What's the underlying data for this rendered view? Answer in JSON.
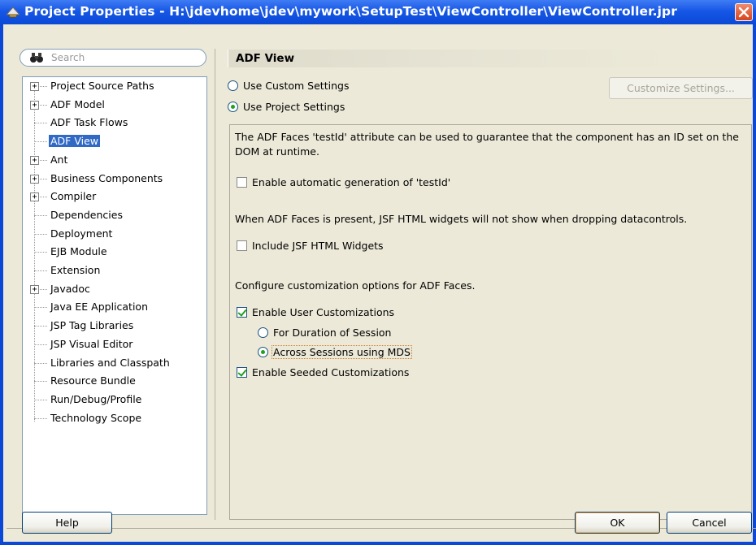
{
  "window": {
    "title": "Project Properties - H:\\jdevhome\\jdev\\mywork\\SetupTest\\ViewController\\ViewController.jpr"
  },
  "search": {
    "placeholder": "Search"
  },
  "tree": {
    "items": [
      {
        "label": "Project Source Paths",
        "expandable": true
      },
      {
        "label": "ADF Model",
        "expandable": true
      },
      {
        "label": "ADF Task Flows",
        "expandable": false
      },
      {
        "label": "ADF View",
        "expandable": false,
        "selected": true
      },
      {
        "label": "Ant",
        "expandable": true
      },
      {
        "label": "Business Components",
        "expandable": true
      },
      {
        "label": "Compiler",
        "expandable": true
      },
      {
        "label": "Dependencies",
        "expandable": false
      },
      {
        "label": "Deployment",
        "expandable": false
      },
      {
        "label": "EJB Module",
        "expandable": false
      },
      {
        "label": "Extension",
        "expandable": false
      },
      {
        "label": "Javadoc",
        "expandable": true
      },
      {
        "label": "Java EE Application",
        "expandable": false
      },
      {
        "label": "JSP Tag Libraries",
        "expandable": false
      },
      {
        "label": "JSP Visual Editor",
        "expandable": false
      },
      {
        "label": "Libraries and Classpath",
        "expandable": false
      },
      {
        "label": "Resource Bundle",
        "expandable": false
      },
      {
        "label": "Run/Debug/Profile",
        "expandable": false
      },
      {
        "label": "Technology Scope",
        "expandable": false
      }
    ]
  },
  "main": {
    "title": "ADF View",
    "use_custom_label": "Use Custom Settings",
    "use_project_label": "Use Project Settings",
    "customize_label": "Customize Settings...",
    "testid_desc": "The ADF Faces 'testId' attribute can be used to guarantee that the component has an ID set on the DOM at runtime.",
    "enable_testid_label": "Enable automatic generation of 'testId'",
    "jsf_desc": "When ADF Faces is present, JSF HTML widgets will not show when dropping datacontrols.",
    "include_jsf_label": "Include JSF HTML Widgets",
    "custom_desc": "Configure customization options for ADF Faces.",
    "enable_user_custom_label": "Enable User Customizations",
    "duration_session_label": "For Duration of Session",
    "across_sessions_label": "Across Sessions using MDS",
    "enable_seeded_label": "Enable Seeded Customizations"
  },
  "buttons": {
    "help": "Help",
    "ok": "OK",
    "cancel": "Cancel"
  },
  "state": {
    "use_project_settings": true,
    "enable_testid": false,
    "include_jsf": false,
    "enable_user_customizations": true,
    "across_sessions": true,
    "enable_seeded": true
  },
  "colors": {
    "titlebar": "#0a49d6",
    "selection": "#316ac5",
    "checkmark": "#21a121",
    "dialog_bg": "#ece9d8"
  }
}
